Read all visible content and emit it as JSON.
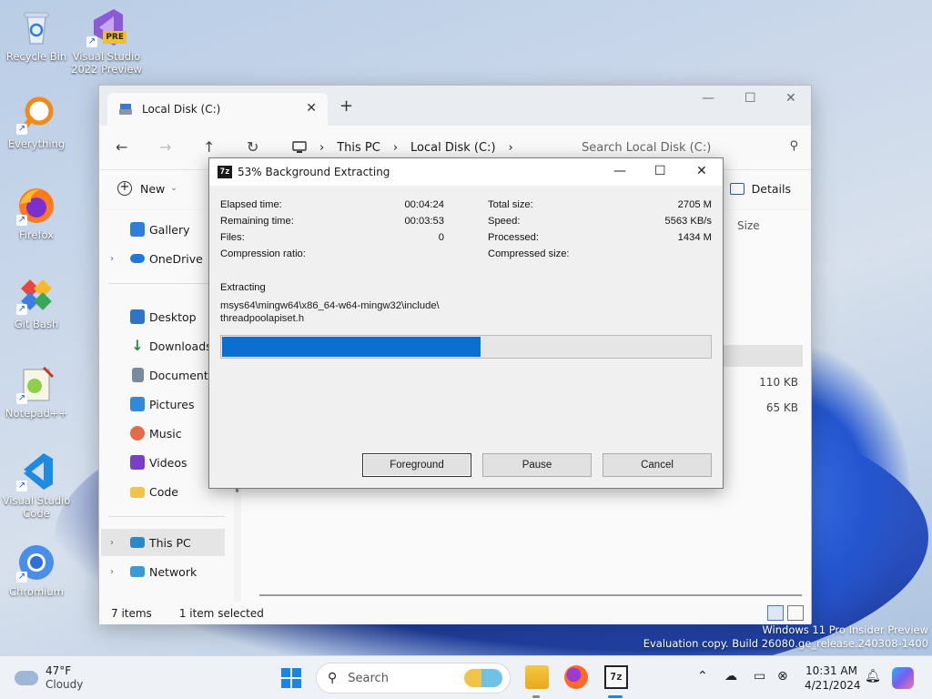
{
  "desktop": {
    "icons": [
      {
        "label": "Recycle Bin",
        "icon": "recycle-bin-icon"
      },
      {
        "label": "Visual Studio 2022 Preview",
        "badge": "PRE",
        "icon": "visual-studio-preview-icon"
      },
      {
        "label": "Everything",
        "icon": "everything-search-icon"
      },
      {
        "label": "Firefox",
        "icon": "firefox-icon"
      },
      {
        "label": "Git Bash",
        "icon": "git-bash-icon"
      },
      {
        "label": "Notepad++",
        "icon": "notepad-plus-plus-icon"
      },
      {
        "label": "Visual Studio Code",
        "icon": "vscode-icon"
      },
      {
        "label": "Chromium",
        "icon": "chromium-icon"
      }
    ],
    "watermark": {
      "line1": "Windows 11 Pro Insider Preview",
      "line2": "Evaluation copy. Build 26080.ge_release.240308-1400"
    }
  },
  "explorer": {
    "tab_title": "Local Disk (C:)",
    "breadcrumb": [
      "This PC",
      "Local Disk (C:)"
    ],
    "search_placeholder": "Search Local Disk (C:)",
    "toolbar": {
      "new_label": "New",
      "details_label": "Details"
    },
    "sidebar": {
      "top_items": [
        {
          "label": "Gallery",
          "color": "#2f7fd8"
        },
        {
          "label": "OneDrive",
          "color": "#1f78d6"
        }
      ],
      "quick_items": [
        {
          "label": "Desktop",
          "color": "#2f74c8"
        },
        {
          "label": "Downloads",
          "color": "#2a8a3e"
        },
        {
          "label": "Documents",
          "color": "#7a8aa0"
        },
        {
          "label": "Pictures",
          "color": "#2f8ad8"
        },
        {
          "label": "Music",
          "color": "#e46b4a"
        },
        {
          "label": "Videos",
          "color": "#7a3fc8"
        },
        {
          "label": "Code",
          "color": "#f2c443"
        }
      ],
      "bottom_items": [
        {
          "label": "This PC",
          "color": "#2a8ac8"
        },
        {
          "label": "Network",
          "color": "#3a9ad8"
        }
      ]
    },
    "columns": {
      "size": "Size"
    },
    "file_sizes": [
      "110 KB",
      "65 KB"
    ],
    "status": {
      "items": "7 items",
      "selected": "1 item selected"
    }
  },
  "dialog": {
    "title": "53% Background Extracting",
    "logo": "7z",
    "stats_left": [
      {
        "label": "Elapsed time:",
        "value": "00:04:24"
      },
      {
        "label": "Remaining time:",
        "value": "00:03:53"
      },
      {
        "label": "Files:",
        "value": "0"
      },
      {
        "label": "Compression ratio:",
        "value": ""
      }
    ],
    "stats_right": [
      {
        "label": "Total size:",
        "value": "2705 M"
      },
      {
        "label": "Speed:",
        "value": "5563 KB/s"
      },
      {
        "label": "Processed:",
        "value": "1434 M"
      },
      {
        "label": "Compressed size:",
        "value": ""
      }
    ],
    "operation": "Extracting",
    "path_line1": "msys64\\mingw64\\x86_64-w64-mingw32\\include\\",
    "path_line2": "threadpoolapiset.h",
    "progress": 0.53,
    "buttons": {
      "foreground": "Foreground",
      "pause": "Pause",
      "cancel": "Cancel"
    }
  },
  "taskbar": {
    "weather": {
      "temp": "47°F",
      "condition": "Cloudy"
    },
    "search_label": "Search",
    "accent": "#1c84e6",
    "clock": {
      "time": "10:31 AM",
      "date": "4/21/2024"
    }
  }
}
